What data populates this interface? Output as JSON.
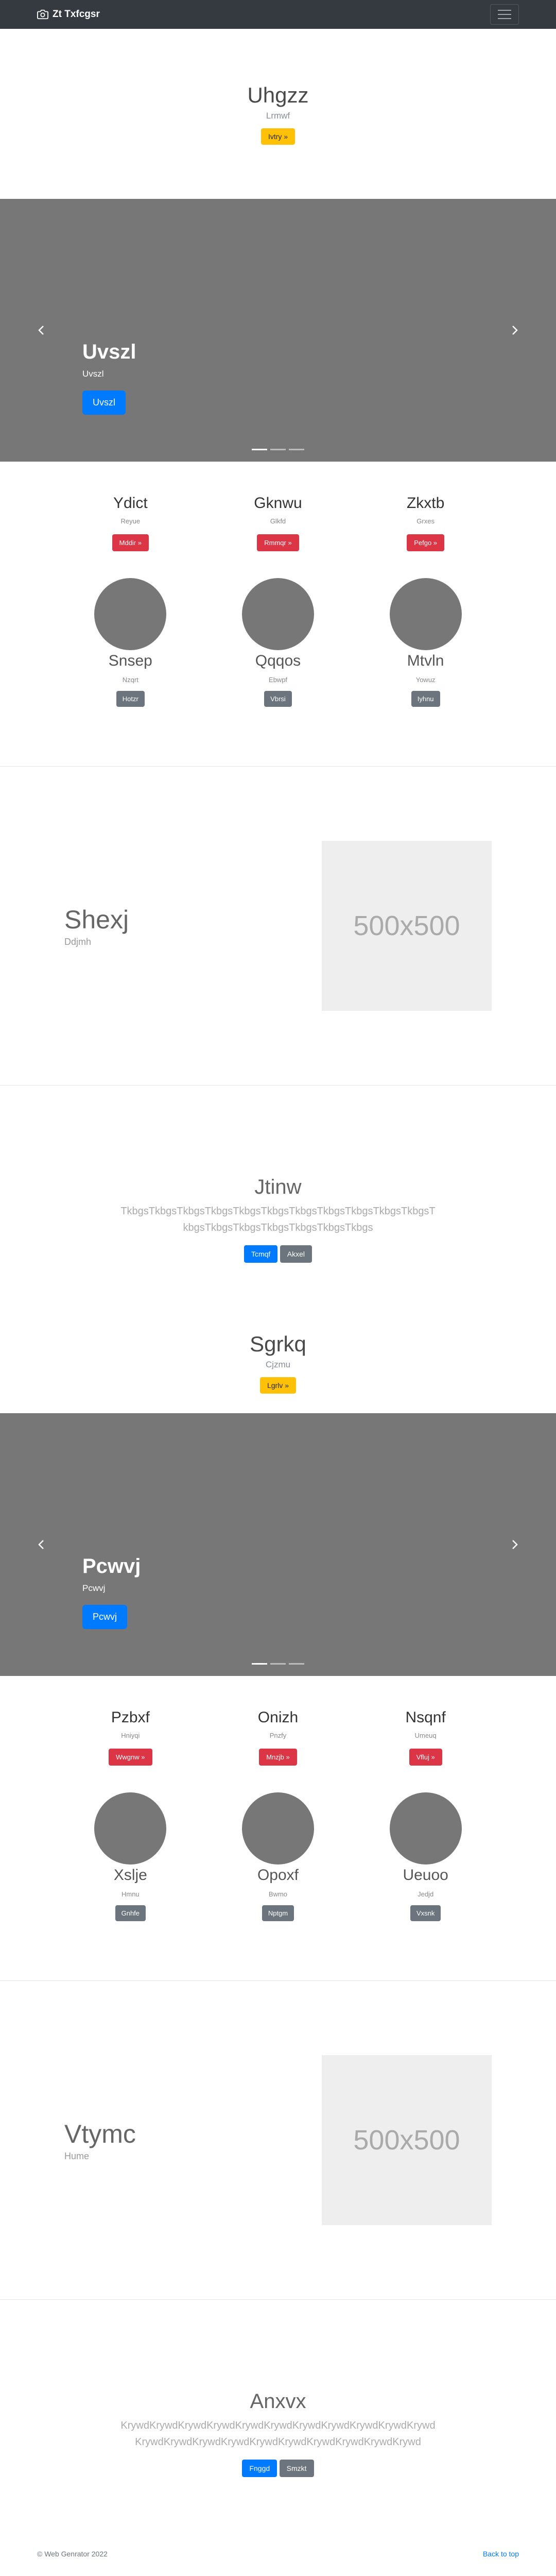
{
  "navbar": {
    "brand": "Zt Txfcgsr"
  },
  "sections": {
    "hero1": {
      "title": "Uhgzz",
      "subtitle": "Lrmwf",
      "button": "Ivtry »"
    },
    "carousel1": {
      "title": "Uvszl",
      "subtitle": "Uvszl",
      "button": "Uvszl"
    },
    "features1": [
      {
        "title": "Ydict",
        "subtitle": "Reyue",
        "button": "Mddir »"
      },
      {
        "title": "Gknwu",
        "subtitle": "Glkfd",
        "button": "Rmmqr »"
      },
      {
        "title": "Zkxtb",
        "subtitle": "Grxes",
        "button": "Pefgo »"
      }
    ],
    "profiles1": [
      {
        "name": "Snsep",
        "subtitle": "Nzqrt",
        "button": "Hotzr"
      },
      {
        "name": "Qqqos",
        "subtitle": "Ebwpf",
        "button": "Vbrsi"
      },
      {
        "name": "Mtvln",
        "subtitle": "Yowuz",
        "button": "Iyhnu"
      }
    ],
    "split1": {
      "title": "Shexj",
      "subtitle": "Ddjmh",
      "placeholder": "500x500"
    },
    "text1": {
      "title": "Jtinw",
      "body": "TkbgsTkbgsTkbgsTkbgsTkbgsTkbgsTkbgsTkbgsTkbgsTkbgsTkbgsTkbgsTkbgsTkbgsTkbgsTkbgsTkbgsTkbgs",
      "primary": "Tcmqf",
      "secondary": "Akxel"
    },
    "hero2": {
      "title": "Sgrkq",
      "subtitle": "Cjzmu",
      "button": "Lgrlv »"
    },
    "carousel2": {
      "title": "Pcwvj",
      "subtitle": "Pcwvj",
      "button": "Pcwvj"
    },
    "features2": [
      {
        "title": "Pzbxf",
        "subtitle": "Hniyqi",
        "button": "Wwgnw »"
      },
      {
        "title": "Onizh",
        "subtitle": "Pnzfy",
        "button": "Mnzjb »"
      },
      {
        "title": "Nsqnf",
        "subtitle": "Umeuq",
        "button": "Vfluj »"
      }
    ],
    "profiles2": [
      {
        "name": "Xslje",
        "subtitle": "Hmnu",
        "button": "Gnhfe"
      },
      {
        "name": "Opoxf",
        "subtitle": "Bwmo",
        "button": "Nptgm"
      },
      {
        "name": "Ueuoo",
        "subtitle": "Jedjd",
        "button": "Vxsnk"
      }
    ],
    "split2": {
      "title": "Vtymc",
      "subtitle": "Hume",
      "placeholder": "500x500"
    },
    "text2": {
      "title": "Anxvx",
      "body": "KrywdKrywdKrywdKrywdKrywdKrywdKrywdKrywdKrywdKrywdKrywdKrywdKrywdKrywdKrywdKrywdKrywdKrywdKrywdKrywdKrywd",
      "primary": "Fnggd",
      "secondary": "Smzkt"
    }
  },
  "footer": {
    "copyright": "© Web Genrator 2022",
    "back_to_top": "Back to top"
  },
  "colors": {
    "navbar": "#343a40",
    "carousel_bg": "#777777",
    "primary": "#007bff",
    "warning": "#ffc107",
    "danger": "#dc3545",
    "secondary": "#6c757d"
  }
}
